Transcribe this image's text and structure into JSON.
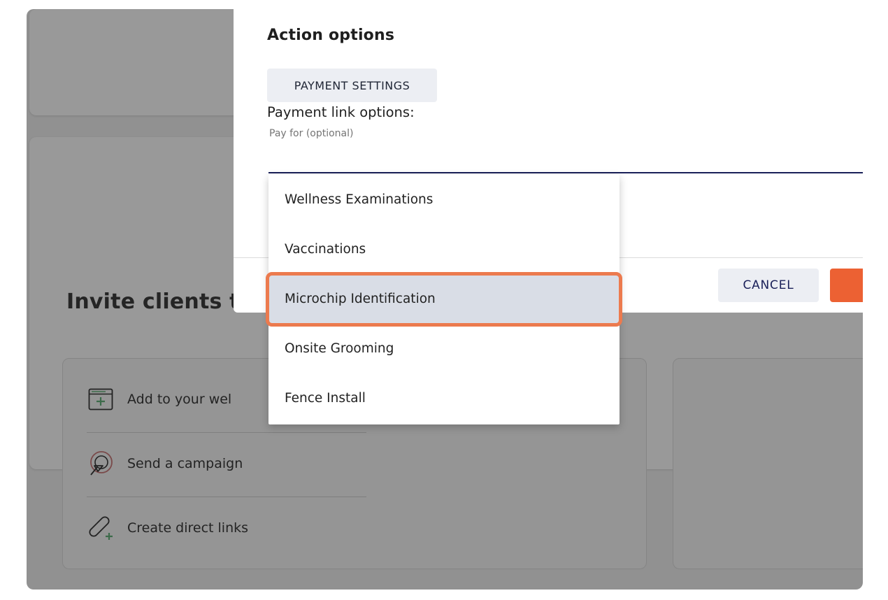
{
  "background": {
    "section_title": "Invite clients to",
    "items": [
      {
        "label": "Add to your wel",
        "icon": "browser-add-icon"
      },
      {
        "label": "Send a campaign",
        "icon": "cursor-click-icon"
      },
      {
        "label": "Create direct links",
        "icon": "link-add-icon"
      }
    ]
  },
  "modal": {
    "title": "Action options",
    "payment_settings_label": "PAYMENT SETTINGS",
    "options_label": "Payment link options:",
    "pay_for_label": "Pay for (optional)",
    "cancel_label": "CANCEL"
  },
  "dropdown": {
    "options": [
      "Wellness Examinations",
      "Vaccinations",
      "Microchip Identification",
      "Onsite Grooming",
      "Fence Install"
    ],
    "selected": "Microchip Identification"
  },
  "colors": {
    "accent": "#ec6133",
    "highlight": "#ec7a4e",
    "navy": "#1a2059",
    "overlay": "#919191"
  }
}
